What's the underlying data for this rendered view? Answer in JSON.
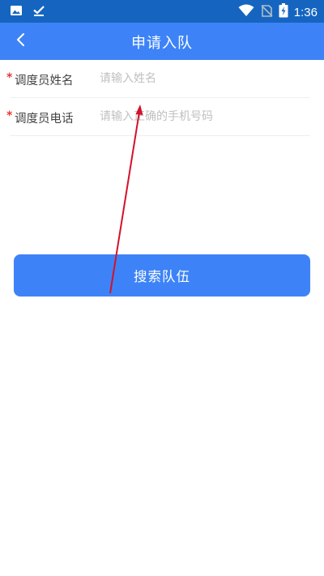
{
  "status_bar": {
    "time": "1:36",
    "icons": [
      "image-icon",
      "download-done-icon",
      "wifi-icon",
      "no-sim-icon",
      "battery-charging-icon"
    ]
  },
  "app_bar": {
    "title": "申请入队",
    "back_icon": "chevron-left-icon"
  },
  "form": {
    "fields": [
      {
        "required_mark": "*",
        "label": "调度员姓名",
        "placeholder": "请输入姓名",
        "value": ""
      },
      {
        "required_mark": "*",
        "label": "调度员电话",
        "placeholder": "请输入正确的手机号码",
        "value": ""
      }
    ]
  },
  "search_button": {
    "label": "搜索队伍"
  },
  "colors": {
    "status_bar": "#1565c0",
    "primary": "#3d83f7",
    "required": "#e53935",
    "annotation_arrow": "#d3112b"
  }
}
